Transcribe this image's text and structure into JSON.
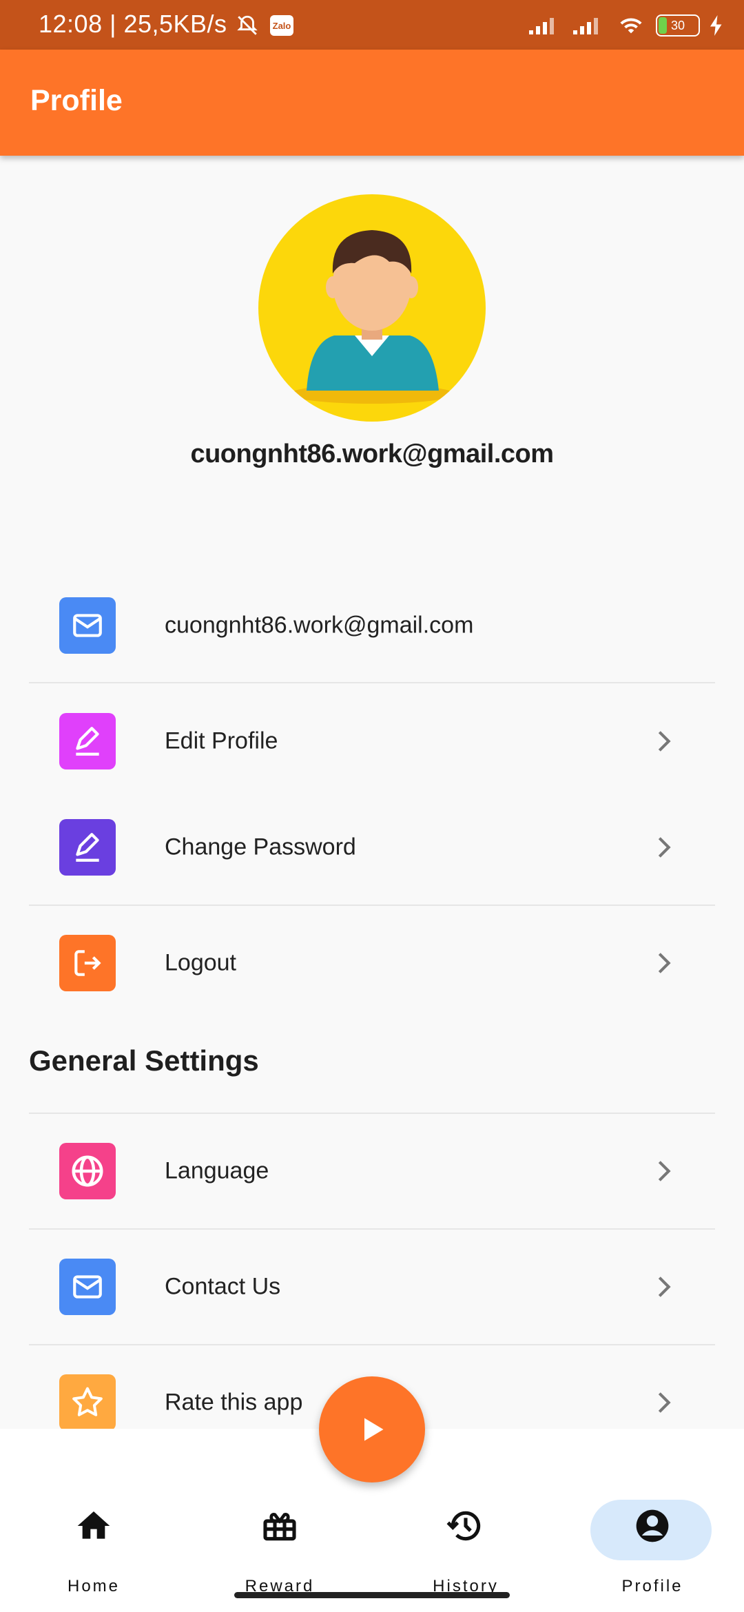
{
  "status_bar": {
    "time_and_speed": "12:08 | 25,5KB/s",
    "zalo_label": "Zalo",
    "battery": "30"
  },
  "app_bar": {
    "title": "Profile"
  },
  "profile": {
    "email": "cuongnht86.work@gmail.com"
  },
  "account_items": [
    {
      "label": "cuongnht86.work@gmail.com",
      "icon": "mail-icon",
      "color": "#4a8af4"
    },
    {
      "label": "Edit Profile",
      "icon": "edit-icon",
      "color": "#e040fb"
    },
    {
      "label": "Change Password",
      "icon": "edit-icon",
      "color": "#6a3fe0"
    },
    {
      "label": "Logout",
      "icon": "logout-icon",
      "color": "#fe7428"
    }
  ],
  "general_settings": {
    "title": "General Settings",
    "items": [
      {
        "label": "Language",
        "icon": "globe-icon",
        "color": "#f5418a"
      },
      {
        "label": "Contact Us",
        "icon": "mail-icon",
        "color": "#4a8af4"
      },
      {
        "label": "Rate this app",
        "icon": "star-icon",
        "color": "#ffa940"
      }
    ]
  },
  "bottom_nav": {
    "items": [
      {
        "label": "Home",
        "icon": "home-icon"
      },
      {
        "label": "Reward",
        "icon": "gift-icon"
      },
      {
        "label": "History",
        "icon": "history-icon"
      },
      {
        "label": "Profile",
        "icon": "account-icon",
        "active": true
      }
    ],
    "fab_icon": "play-icon"
  },
  "colors": {
    "accent": "#fe7428",
    "status_bar": "#c4531a",
    "active_pill": "#d7e9fb"
  }
}
